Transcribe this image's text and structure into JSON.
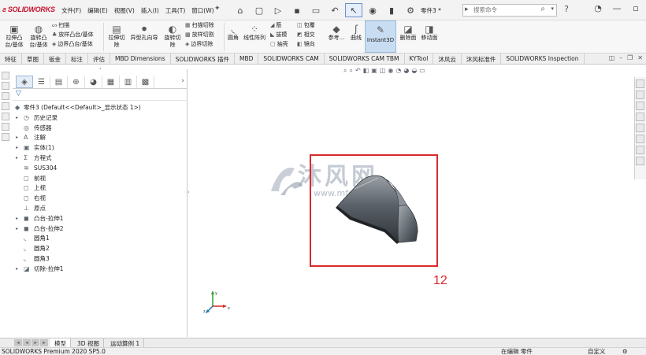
{
  "app": {
    "logo_text": "SOLIDWORKS",
    "menu": [
      "文件(F)",
      "编辑(E)",
      "视图(V)",
      "插入(I)",
      "工具(T)",
      "窗口(W)"
    ],
    "document_name": "零件3 *",
    "search_placeholder": "搜索命令",
    "quick_access_icons": [
      "home-icon",
      "new-file-icon",
      "open-icon",
      "save-icon",
      "print-icon",
      "undo-icon",
      "select-icon",
      "rebuild-icon",
      "file-properties-icon",
      "options-icon"
    ],
    "window_controls": [
      "minimize-icon",
      "restore-icon",
      "close-icon"
    ]
  },
  "ribbon": {
    "extrude_boss": "拉伸凸台/基体",
    "revolve_boss": "旋转凸台/基体",
    "sweep": "扫描",
    "loft": "放样凸台/基体",
    "boundary_boss": "边界凸台/基体",
    "extrude_cut": "拉伸切除",
    "hole_wizard": "异型孔向导",
    "revolve_cut": "旋转切除",
    "swept_cut": "扫描切除",
    "lofted_cut": "放样切割",
    "boundary_cut": "边界切除",
    "fillet": "圆角",
    "linear_pattern": "线性阵列",
    "rib": "筋",
    "draft": "拔模",
    "shell": "抽壳",
    "wrap": "包覆",
    "intersect": "相交",
    "mirror": "镜向",
    "reference": "参考...",
    "curves": "曲线",
    "instant3d": "Instant3D",
    "delete_face": "删除面",
    "move_face": "移动面"
  },
  "command_tabs": [
    "特征",
    "草图",
    "钣金",
    "标注",
    "评估",
    "MBD Dimensions",
    "SOLIDWORKS 插件",
    "MBD",
    "SOLIDWORKS CAM",
    "SOLIDWORKS CAM TBM",
    "KYTool",
    "沐风云",
    "沐风标准件",
    "SOLIDWORKS Inspection"
  ],
  "feature_tree": {
    "root": "零件3  (Default<<Default>_显示状态 1>)",
    "items": [
      {
        "label": "历史记录",
        "icon": "history-icon",
        "expandable": true
      },
      {
        "label": "传感器",
        "icon": "sensor-icon",
        "expandable": false
      },
      {
        "label": "注解",
        "icon": "annotation-icon",
        "expandable": true
      },
      {
        "label": "实体(1)",
        "icon": "solid-body-icon",
        "expandable": true
      },
      {
        "label": "方程式",
        "icon": "equation-icon",
        "expandable": true
      },
      {
        "label": "SUS304",
        "icon": "material-icon",
        "expandable": false
      },
      {
        "label": "前视",
        "icon": "plane-icon",
        "expandable": false
      },
      {
        "label": "上视",
        "icon": "plane-icon",
        "expandable": false
      },
      {
        "label": "右视",
        "icon": "plane-icon",
        "expandable": false
      },
      {
        "label": "原点",
        "icon": "origin-icon",
        "expandable": false
      },
      {
        "label": "凸台-拉伸1",
        "icon": "extrude-feature-icon",
        "expandable": true
      },
      {
        "label": "凸台-拉伸2",
        "icon": "extrude-feature-icon",
        "expandable": true
      },
      {
        "label": "圆角1",
        "icon": "fillet-feature-icon",
        "expandable": false
      },
      {
        "label": "圆角2",
        "icon": "fillet-feature-icon",
        "expandable": false
      },
      {
        "label": "圆角3",
        "icon": "fillet-feature-icon",
        "expandable": false
      },
      {
        "label": "切除-拉伸1",
        "icon": "cut-feature-icon",
        "expandable": true
      }
    ]
  },
  "graphics": {
    "annotation_label": "12",
    "watermark_text": "沐风网",
    "watermark_url": "www.mfcad.com",
    "triad_axes": [
      "y",
      "z",
      "x"
    ]
  },
  "bottom_tabs": [
    "模型",
    "3D 视图",
    "运动算例 1"
  ],
  "status": {
    "product": "SOLIDWORKS Premium 2020 SP5.0",
    "mode": "在编辑 零件",
    "units": "自定义"
  },
  "colors": {
    "accent_red": "#d9292b",
    "logo_red": "#c8102e",
    "selection_blue": "#c9ddf2"
  }
}
